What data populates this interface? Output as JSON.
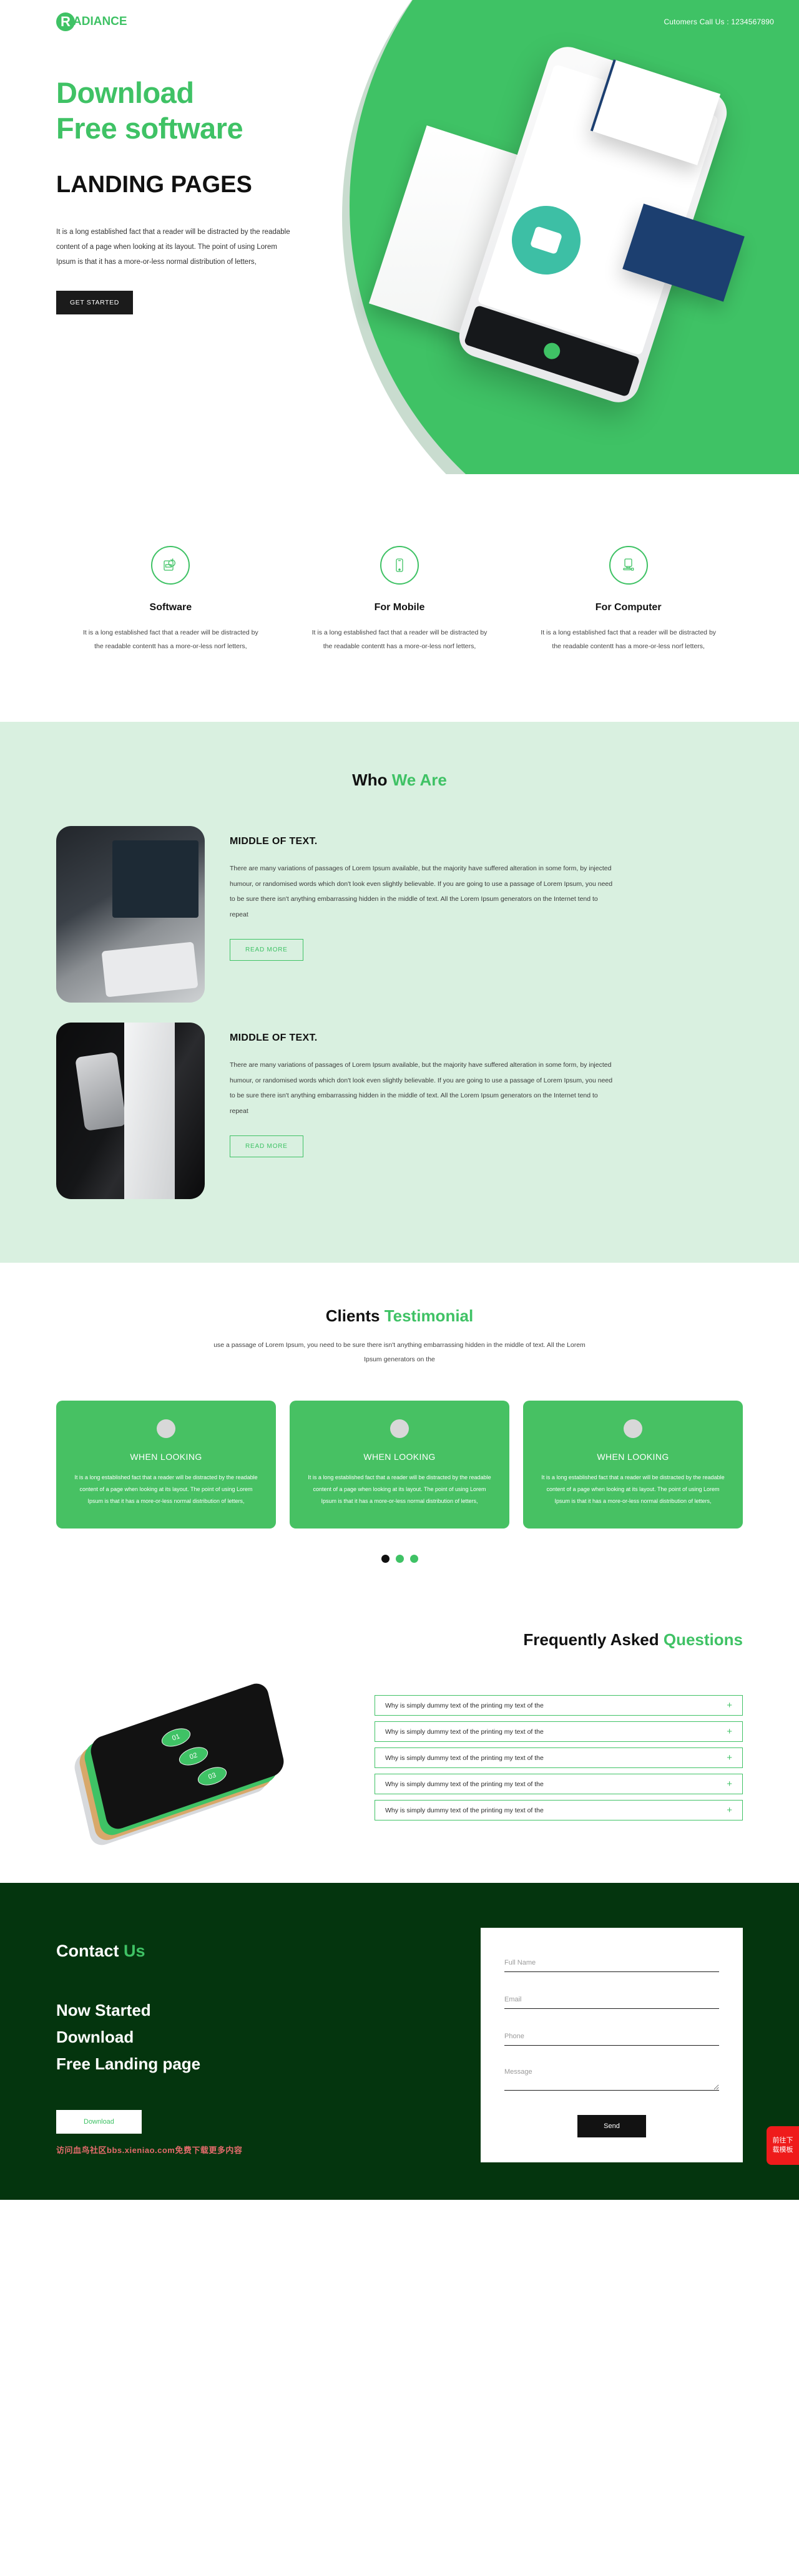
{
  "brand": {
    "logo_badge": "R",
    "logo_text": "ADIANCE",
    "green": "#3fc265",
    "dark_green": "#04350e"
  },
  "hero": {
    "contact_label": "Cutomers Call Us : 1234567890",
    "heading_line1": "Download",
    "heading_line2": "Free software",
    "subheading": "LANDING PAGES",
    "paragraph": "It is a long established fact that a reader will be distracted by the readable content of a page when looking at its layout. The point of using Lorem Ipsum is that it has a more-or-less normal distribution of letters,",
    "cta": "GET STARTED"
  },
  "features": [
    {
      "icon": "software-sync-icon",
      "title": "Software",
      "text": "It is a long established fact that a reader will be distracted by the readable contentt has a more-or-less norf letters,"
    },
    {
      "icon": "mobile-phone-icon",
      "title": "For Mobile",
      "text": "It is a long established fact that a reader will be distracted by the readable contentt has a more-or-less norf letters,"
    },
    {
      "icon": "desktop-computer-icon",
      "title": "For Computer",
      "text": "It is a long established fact that a reader will be distracted by the readable contentt has a more-or-less norf letters,"
    }
  ],
  "who": {
    "title_plain": "Who ",
    "title_accent": "We Are",
    "blocks": [
      {
        "image_alt": "person-at-imac-photo",
        "heading": "MIDDLE OF TEXT.",
        "paragraph": "There are many variations of passages of Lorem Ipsum available, but the majority have suffered alteration in some form, by injected humour, or randomised words which don't look even slightly believable. If you are going to use a passage of Lorem Ipsum, you need to be sure there isn't anything embarrassing hidden in the middle of text. All the Lorem Ipsum generators on the Internet tend to repeat",
        "button": "READ MORE"
      },
      {
        "image_alt": "hand-holding-smartphone-photo",
        "heading": "MIDDLE OF TEXT.",
        "paragraph": "There are many variations of passages of Lorem Ipsum available, but the majority have suffered alteration in some form, by injected humour, or randomised words which don't look even slightly believable. If you are going to use a passage of Lorem Ipsum, you need to be sure there isn't anything embarrassing hidden in the middle of text. All the Lorem Ipsum generators on the Internet tend to repeat",
        "button": "READ MORE"
      }
    ]
  },
  "testimonial": {
    "title_plain": "Clients ",
    "title_accent": "Testimonial",
    "subtitle": "use a passage of Lorem Ipsum, you need to be sure there isn't anything embarrassing hidden in the middle of text. All the Lorem Ipsum generators on the",
    "cards": [
      {
        "name": "WHEN LOOKING",
        "text": "It is a long established fact that a reader will be distracted by the readable content of a page when looking at its layout. The point of using Lorem Ipsum is that it has a more-or-less normal distribution of letters,"
      },
      {
        "name": "WHEN LOOKING",
        "text": "It is a long established fact that a reader will be distracted by the readable content of a page when looking at its layout. The point of using Lorem Ipsum is that it has a more-or-less normal distribution of letters,"
      },
      {
        "name": "WHEN LOOKING",
        "text": "It is a long established fact that a reader will be distracted by the readable content of a page when looking at its layout. The point of using Lorem Ipsum is that it has a more-or-less normal distribution of letters,"
      }
    ],
    "dots": [
      "active",
      "inactive",
      "inactive"
    ]
  },
  "faq": {
    "title_plain": "Frequently Asked ",
    "title_accent": "Questions",
    "art_labels": [
      "01",
      "02",
      "03"
    ],
    "items": [
      {
        "question": "Why is simply dummy text of the printing my text of the",
        "toggle": "+"
      },
      {
        "question": "Why is simply dummy text of the printing my text of the",
        "toggle": "+"
      },
      {
        "question": "Why is simply dummy text of the printing my text of the",
        "toggle": "+"
      },
      {
        "question": "Why is simply dummy text of the printing my text of the",
        "toggle": "+"
      },
      {
        "question": "Why is simply dummy text of the printing my text of the",
        "toggle": "+"
      }
    ]
  },
  "contact": {
    "title_plain": "Contact ",
    "title_accent": "Us",
    "headline_line1": "Now Started",
    "headline_line2": "Download",
    "headline_line3": "Free Landing page",
    "download_button": "Download",
    "watermark": "访问血鸟社区bbs.xieniao.com免费下载更多内容",
    "form": {
      "fullname_placeholder": "Full Name",
      "fullname_value": "",
      "email_placeholder": "Email",
      "email_value": "",
      "phone_placeholder": "Phone",
      "phone_value": "",
      "message_placeholder": "Message",
      "message_value": "",
      "send_button": "Send"
    },
    "float_cta": "前往下载模板"
  }
}
